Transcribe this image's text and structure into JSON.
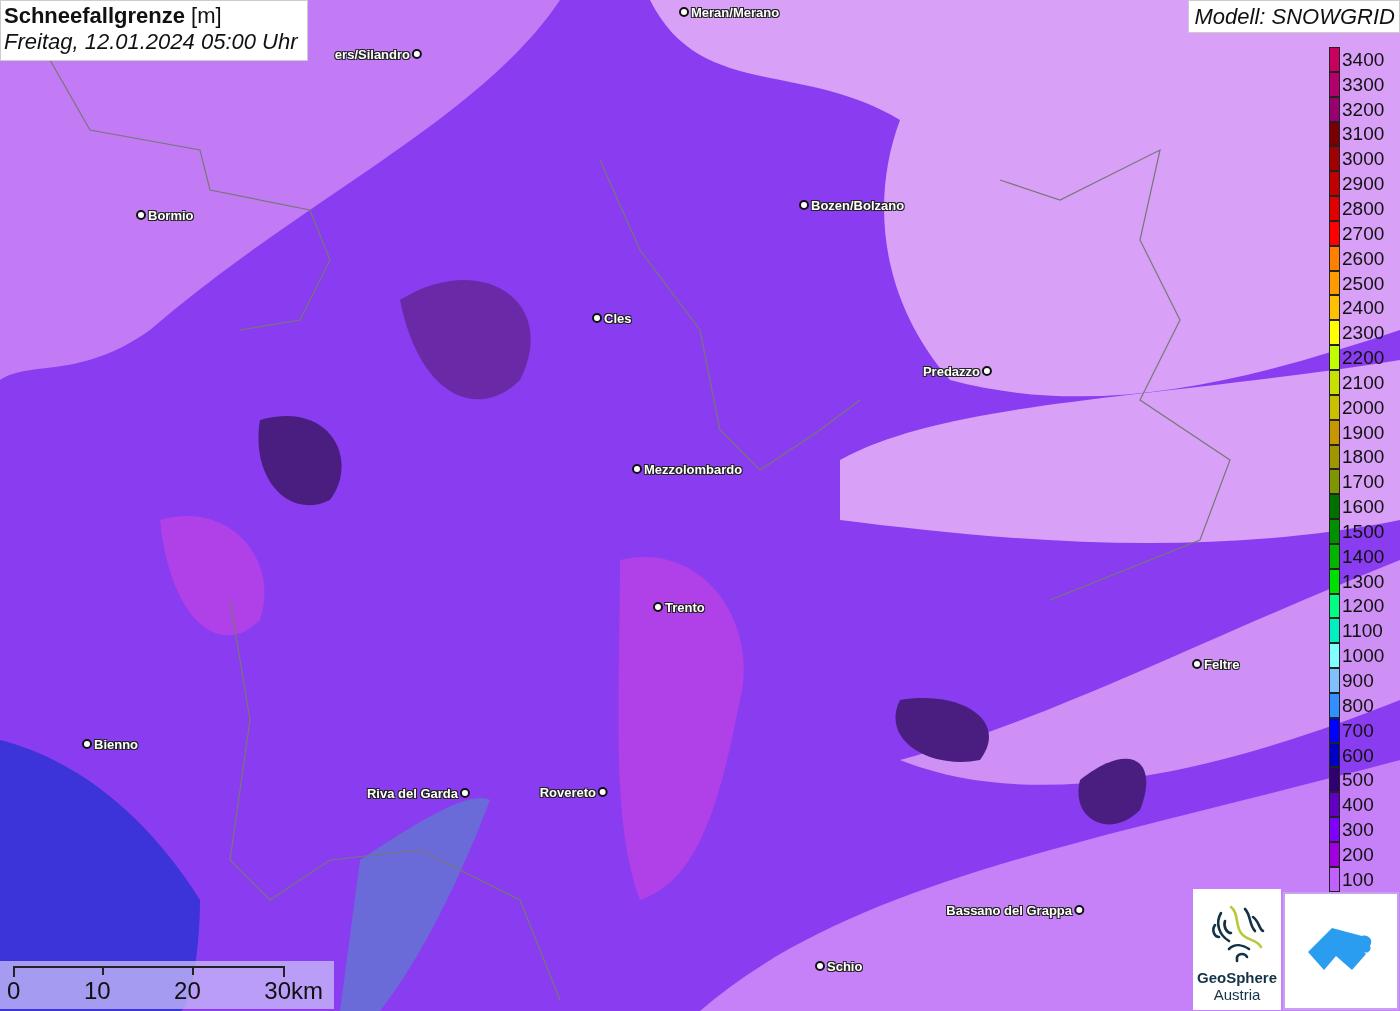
{
  "title": {
    "name": "Schneefallgrenze",
    "unit": "[m]",
    "time": "Freitag, 12.01.2024 05:00 Uhr"
  },
  "model": "Modell: SNOWGRID",
  "places": [
    {
      "name": "Meran/Merano"
    },
    {
      "name": "ers/Silandro"
    },
    {
      "name": "Bormio"
    },
    {
      "name": "Bozen/Bolzano"
    },
    {
      "name": "Cles"
    },
    {
      "name": "Predazzo"
    },
    {
      "name": "Mezzolombardo"
    },
    {
      "name": "Trento"
    },
    {
      "name": "Feltre"
    },
    {
      "name": "Bienno"
    },
    {
      "name": "Riva del Garda"
    },
    {
      "name": "Rovereto"
    },
    {
      "name": "Bassano del Grappa"
    },
    {
      "name": "Schio"
    }
  ],
  "legend": [
    {
      "label": "3400",
      "color": "#c8005e"
    },
    {
      "label": "3300",
      "color": "#b4006c"
    },
    {
      "label": "3200",
      "color": "#980070"
    },
    {
      "label": "3100",
      "color": "#780000"
    },
    {
      "label": "3000",
      "color": "#a00000"
    },
    {
      "label": "2900",
      "color": "#c00000"
    },
    {
      "label": "2800",
      "color": "#e00000"
    },
    {
      "label": "2700",
      "color": "#ff0000"
    },
    {
      "label": "2600",
      "color": "#ff8000"
    },
    {
      "label": "2500",
      "color": "#ff9a00"
    },
    {
      "label": "2400",
      "color": "#ffc000"
    },
    {
      "label": "2300",
      "color": "#ffff00"
    },
    {
      "label": "2200",
      "color": "#c0ff00"
    },
    {
      "label": "2100",
      "color": "#c8e000"
    },
    {
      "label": "2000",
      "color": "#c8c000"
    },
    {
      "label": "1900",
      "color": "#c89600"
    },
    {
      "label": "1800",
      "color": "#a09600"
    },
    {
      "label": "1700",
      "color": "#809600"
    },
    {
      "label": "1600",
      "color": "#007000"
    },
    {
      "label": "1500",
      "color": "#009000"
    },
    {
      "label": "1400",
      "color": "#00b400"
    },
    {
      "label": "1300",
      "color": "#00e000"
    },
    {
      "label": "1200",
      "color": "#00ff80"
    },
    {
      "label": "1100",
      "color": "#00f0c0"
    },
    {
      "label": "1000",
      "color": "#80ffff"
    },
    {
      "label": "900",
      "color": "#80c0ff"
    },
    {
      "label": "800",
      "color": "#3090ff"
    },
    {
      "label": "700",
      "color": "#0000ff"
    },
    {
      "label": "600",
      "color": "#0000c0"
    },
    {
      "label": "500",
      "color": "#300070"
    },
    {
      "label": "400",
      "color": "#6000c0"
    },
    {
      "label": "300",
      "color": "#8000ff"
    },
    {
      "label": "200",
      "color": "#a000e0"
    },
    {
      "label": "100",
      "color": "#c060ff"
    }
  ],
  "scale": {
    "ticks": [
      "0",
      "10",
      "20",
      "30km"
    ]
  },
  "logos": {
    "name": "GeoSphere",
    "sub": "Austria"
  }
}
